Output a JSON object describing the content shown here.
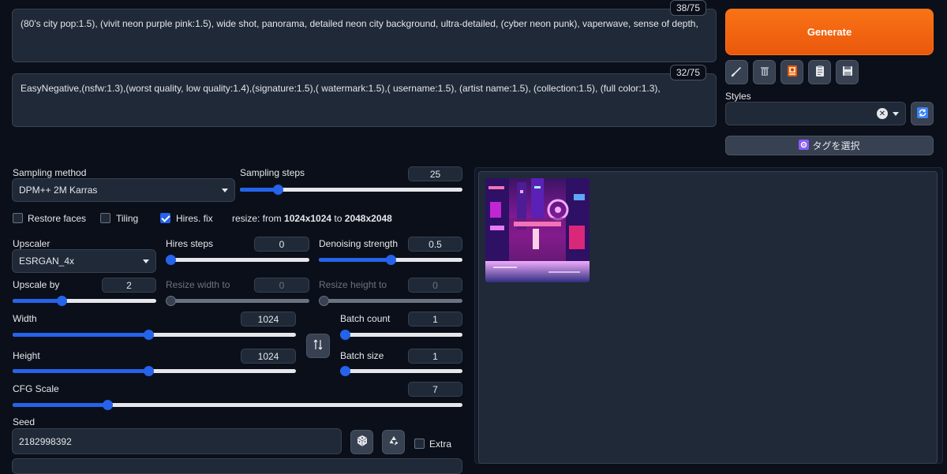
{
  "prompt": {
    "positive": "(80's city pop:1.5), (vivit neon purple pink:1.5), wide shot, panorama, detailed neon city background, ultra-detailed, (cyber neon punk), vaperwave, sense of depth,",
    "positive_tokens": "38/75",
    "negative": "EasyNegative,(nsfw:1.3),(worst quality, low quality:1.4),(signature:1.5),( watermark:1.5),( username:1.5), (artist name:1.5), (collection:1.5), (full color:1.3),",
    "negative_tokens": "32/75"
  },
  "actions": {
    "generate_label": "Generate",
    "styles_label": "Styles",
    "tag_select_label": "タグを選択",
    "tool_icons": [
      "brush-icon",
      "trash-icon",
      "card-icon",
      "clipboard-icon",
      "save-icon"
    ]
  },
  "params": {
    "sampling_method_label": "Sampling method",
    "sampling_method_value": "DPM++ 2M Karras",
    "sampling_steps_label": "Sampling steps",
    "sampling_steps_value": "25",
    "restore_faces_label": "Restore faces",
    "tiling_label": "Tiling",
    "hires_fix_label": "Hires. fix",
    "resize_prefix": "resize: from ",
    "resize_from": "1024x1024",
    "resize_to_word": " to ",
    "resize_to": "2048x2048",
    "upscaler_label": "Upscaler",
    "upscaler_value": "ESRGAN_4x",
    "hires_steps_label": "Hires steps",
    "hires_steps_value": "0",
    "denoising_label": "Denoising strength",
    "denoising_value": "0.5",
    "upscale_by_label": "Upscale by",
    "upscale_by_value": "2",
    "resize_width_label": "Resize width to",
    "resize_width_value": "0",
    "resize_height_label": "Resize height to",
    "resize_height_value": "0",
    "width_label": "Width",
    "width_value": "1024",
    "height_label": "Height",
    "height_value": "1024",
    "batch_count_label": "Batch count",
    "batch_count_value": "1",
    "batch_size_label": "Batch size",
    "batch_size_value": "1",
    "cfg_label": "CFG Scale",
    "cfg_value": "7",
    "seed_label": "Seed",
    "seed_value": "2182998392",
    "extra_label": "Extra"
  },
  "sliders": {
    "sampling_steps": 0.17,
    "hires_steps": 0.0,
    "denoising": 0.5,
    "upscale_by": 0.34,
    "resize_width": 0.0,
    "resize_height": 0.0,
    "width": 0.48,
    "height": 0.48,
    "batch_count": 0.0,
    "batch_size": 0.0,
    "cfg": 0.21
  },
  "colors": {
    "accent": "#2563eb",
    "generate": "#f97316",
    "background": "#0b0f19"
  }
}
